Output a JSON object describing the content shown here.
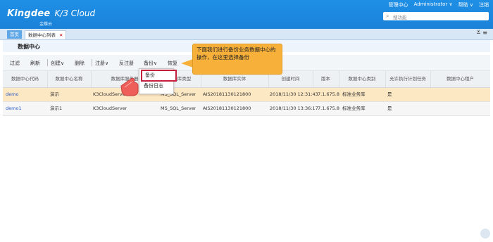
{
  "app": {
    "brand": "Kingdee",
    "product": "K/3 Cloud",
    "brand_cn": "金蝶云"
  },
  "top_menu": {
    "admin_center": "管理中心",
    "user": "Administrator ∨",
    "help": "帮助 ∨",
    "logout": "注销"
  },
  "search": {
    "placeholder": "搜功能"
  },
  "tabs": {
    "home": "首页",
    "active": "数据中心列表"
  },
  "page": {
    "title": "数据中心"
  },
  "toolbar": {
    "filter": "过滤",
    "refresh": "刷新",
    "create": "创建∨",
    "delete": "删除",
    "register": "注册∨",
    "unregister": "反注册",
    "backup": "备份∨",
    "restore": "恢复",
    "more": "升"
  },
  "backup_menu": {
    "backup": "备份",
    "backup_log": "备份日志"
  },
  "tooltip": {
    "text": "下面我们进行备份业务数据中心的操作，在这里选择备份"
  },
  "table": {
    "headers": [
      "数据中心代码",
      "数据中心名称",
      "数据库服务器",
      "数据库类型",
      "数据库实体",
      "创建时间",
      "版本",
      "数据中心类别",
      "允许执行计划任务",
      "数据中心租户"
    ],
    "rows": [
      [
        "demo",
        "演示",
        "K3CloudServer",
        "MS_SQL_Server",
        "AIS20181130121800",
        "2018/11/30 12:31:43",
        "7.1.675.8",
        "标准业务库",
        "是",
        ""
      ],
      [
        "demo1",
        "演示1",
        "K3CloudServer",
        "MS_SQL_Server",
        "AIS20181130121800",
        "2018/11/30 13:36:17",
        "7.1.675.8",
        "标准业务库",
        "是",
        ""
      ]
    ]
  },
  "colors": {
    "top_blue": "#1a82d8",
    "selected_row": "#fde8c4",
    "tooltip": "#f7b13a",
    "highlight": "#c41f3c"
  }
}
